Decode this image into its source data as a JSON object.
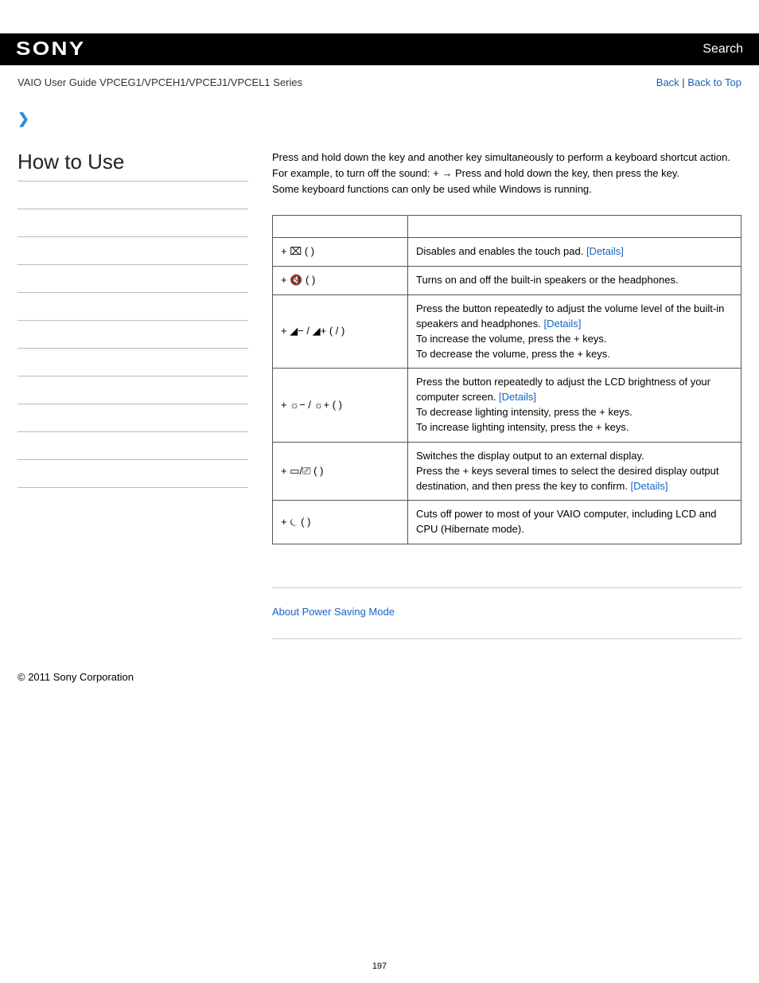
{
  "header": {
    "logo": "SONY",
    "search": "Search"
  },
  "subheader": {
    "title": "VAIO User Guide VPCEG1/VPCEH1/VPCEJ1/VPCEL1 Series",
    "back": "Back",
    "sep": " | ",
    "back_to_top": "Back to Top"
  },
  "sidebar": {
    "title": "How to Use"
  },
  "intro": {
    "l1a": "Press and hold down the ",
    "l1b": " key and another key simultaneously to perform a keyboard shortcut action.",
    "l2a": "For example, to turn off the sound: ",
    "l2b": " + ",
    "l2c": " → Press and hold down the ",
    "l2d": " key, then press the ",
    "l2e": " key.",
    "l3": "Some keyboard functions can only be used while Windows is running."
  },
  "table": {
    "rows": [
      {
        "key_prefix": " + ",
        "glyph": "⌧",
        "key_suffix": " (      )",
        "desc": "Disables and enables the touch pad. ",
        "details": "[Details]"
      },
      {
        "key_prefix": " + ",
        "glyph": "🔇",
        "key_suffix": " (      )",
        "desc": "Turns on and off the built-in speakers or the headphones.",
        "details": ""
      },
      {
        "key_prefix": " + ",
        "glyph": "◢− / ◢+",
        "key_suffix": " (     /     )",
        "desc_a": "Press the button repeatedly to adjust the volume level of the built-in speakers and headphones. ",
        "details": "[Details]",
        "desc_b": "To increase the volume, press the       +       keys.",
        "desc_c": "To decrease the volume, press the       +       keys."
      },
      {
        "key_prefix": " + ",
        "glyph": "☼− / ☼+",
        "key_suffix": " (                 )",
        "desc_a": "Press the button repeatedly to adjust the LCD brightness of your computer screen. ",
        "details": "[Details]",
        "desc_b": "To decrease lighting intensity, press the       +       keys.",
        "desc_c": "To increase lighting intensity, press the       +       keys."
      },
      {
        "key_prefix": " + ",
        "glyph": "▭/⎚",
        "key_suffix": " (      )",
        "desc_a": "Switches the display output to an external display.",
        "desc_b": "Press the       +       keys several times to select the desired display output destination, and then press the             key to confirm. ",
        "details": "[Details]"
      },
      {
        "key_prefix": " + ",
        "glyph": "⏾",
        "key_suffix": " (      )",
        "desc": "Cuts off power to most of your VAIO computer, including LCD and CPU (Hibernate mode).",
        "details": ""
      }
    ]
  },
  "related": {
    "link": "About Power Saving Mode"
  },
  "footer": {
    "copyright": "© 2011 Sony Corporation",
    "page": "197"
  }
}
